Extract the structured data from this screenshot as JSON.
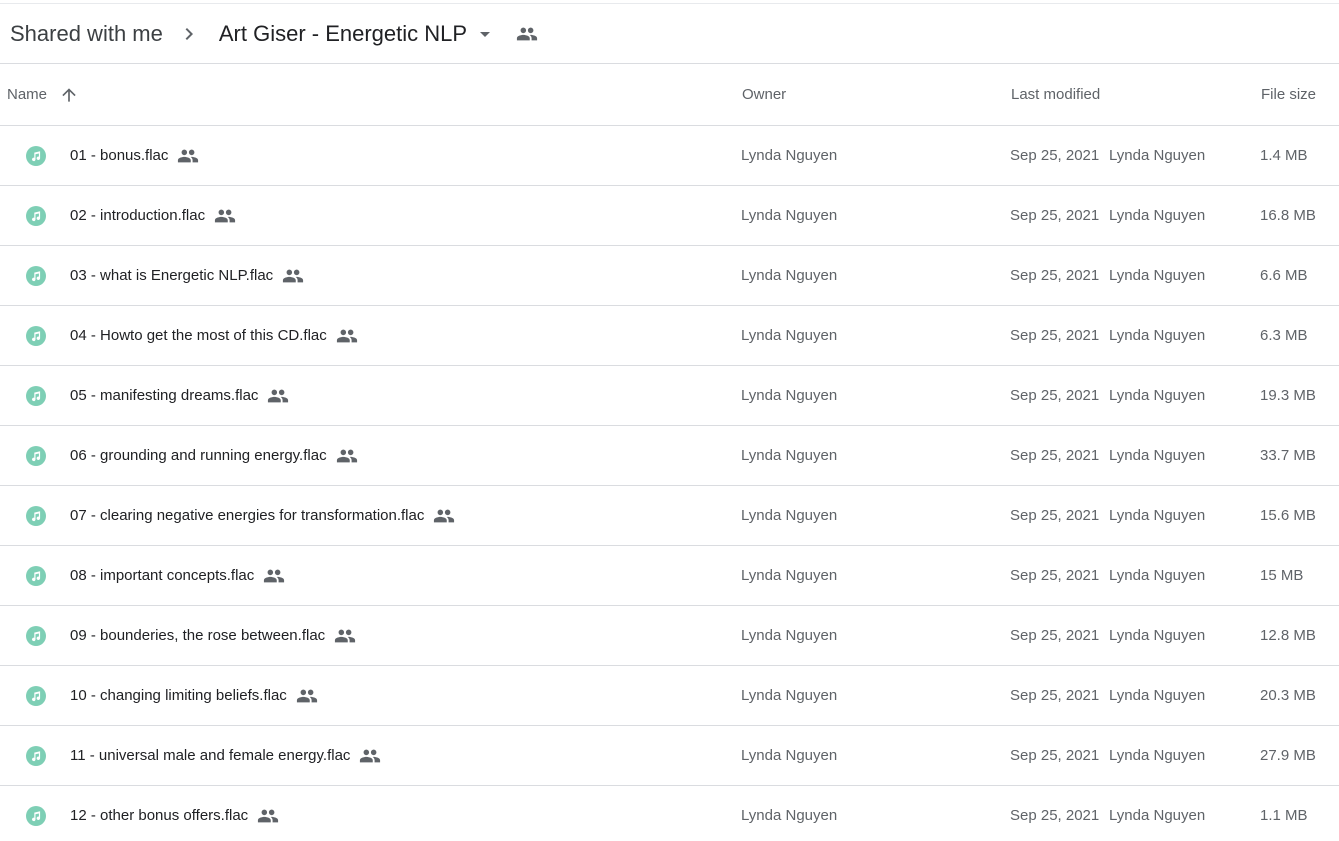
{
  "breadcrumb": {
    "root": "Shared with me",
    "current": "Art Giser - Energetic NLP"
  },
  "columns": {
    "name": "Name",
    "owner": "Owner",
    "last_modified": "Last modified",
    "file_size": "File size"
  },
  "icons": {
    "breadcrumb_separator": "chevron-right-icon",
    "folder_menu": "arrow-drop-down-icon",
    "shared": "people-icon",
    "sort": "arrow-upward-icon",
    "file_type": "audio-file-icon"
  },
  "colors": {
    "audio_icon": "#81c995",
    "audio_icon_fill": "#5bb98c",
    "text_primary": "#202124",
    "text_secondary": "#5f6368",
    "divider": "#dadce0"
  },
  "files": [
    {
      "name": "01 - bonus.flac",
      "owner": "Lynda Nguyen",
      "modified_date": "Sep 25, 2021",
      "modified_by": "Lynda Nguyen",
      "size": "1.4 MB"
    },
    {
      "name": "02 - introduction.flac",
      "owner": "Lynda Nguyen",
      "modified_date": "Sep 25, 2021",
      "modified_by": "Lynda Nguyen",
      "size": "16.8 MB"
    },
    {
      "name": "03 - what is Energetic NLP.flac",
      "owner": "Lynda Nguyen",
      "modified_date": "Sep 25, 2021",
      "modified_by": "Lynda Nguyen",
      "size": "6.6 MB"
    },
    {
      "name": "04 - Howto get the most of this CD.flac",
      "owner": "Lynda Nguyen",
      "modified_date": "Sep 25, 2021",
      "modified_by": "Lynda Nguyen",
      "size": "6.3 MB"
    },
    {
      "name": "05 - manifesting dreams.flac",
      "owner": "Lynda Nguyen",
      "modified_date": "Sep 25, 2021",
      "modified_by": "Lynda Nguyen",
      "size": "19.3 MB"
    },
    {
      "name": "06 - grounding and running energy.flac",
      "owner": "Lynda Nguyen",
      "modified_date": "Sep 25, 2021",
      "modified_by": "Lynda Nguyen",
      "size": "33.7 MB"
    },
    {
      "name": "07 - clearing negative energies for transformation.flac",
      "owner": "Lynda Nguyen",
      "modified_date": "Sep 25, 2021",
      "modified_by": "Lynda Nguyen",
      "size": "15.6 MB"
    },
    {
      "name": "08 - important concepts.flac",
      "owner": "Lynda Nguyen",
      "modified_date": "Sep 25, 2021",
      "modified_by": "Lynda Nguyen",
      "size": "15 MB"
    },
    {
      "name": "09 - bounderies, the rose between.flac",
      "owner": "Lynda Nguyen",
      "modified_date": "Sep 25, 2021",
      "modified_by": "Lynda Nguyen",
      "size": "12.8 MB"
    },
    {
      "name": "10 - changing limiting beliefs.flac",
      "owner": "Lynda Nguyen",
      "modified_date": "Sep 25, 2021",
      "modified_by": "Lynda Nguyen",
      "size": "20.3 MB"
    },
    {
      "name": "11 - universal male and female energy.flac",
      "owner": "Lynda Nguyen",
      "modified_date": "Sep 25, 2021",
      "modified_by": "Lynda Nguyen",
      "size": "27.9 MB"
    },
    {
      "name": "12 - other bonus offers.flac",
      "owner": "Lynda Nguyen",
      "modified_date": "Sep 25, 2021",
      "modified_by": "Lynda Nguyen",
      "size": "1.1 MB"
    }
  ]
}
